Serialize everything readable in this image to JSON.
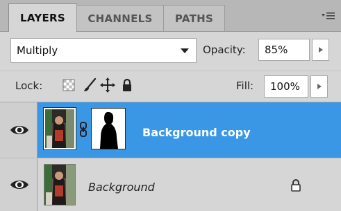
{
  "tabs": [
    {
      "label": "LAYERS",
      "active": true
    },
    {
      "label": "CHANNELS",
      "active": false
    },
    {
      "label": "PATHS",
      "active": false
    }
  ],
  "blend_mode": "Multiply",
  "opacity": {
    "label": "Opacity:",
    "value": "85%"
  },
  "lock": {
    "label": "Lock:",
    "icons": [
      "lock-transparent-pixels-icon",
      "lock-image-pixels-icon",
      "lock-position-icon",
      "lock-all-icon"
    ]
  },
  "fill": {
    "label": "Fill:",
    "value": "100%"
  },
  "layers": [
    {
      "name": "Background copy",
      "visible": true,
      "selected": true,
      "has_mask": true,
      "locked": false
    },
    {
      "name": "Background",
      "visible": true,
      "selected": false,
      "has_mask": false,
      "locked": true
    }
  ],
  "colors": {
    "selection": "#3a97e6",
    "panel": "#d6d6d6",
    "tab_strip": "#b7b7b7"
  }
}
